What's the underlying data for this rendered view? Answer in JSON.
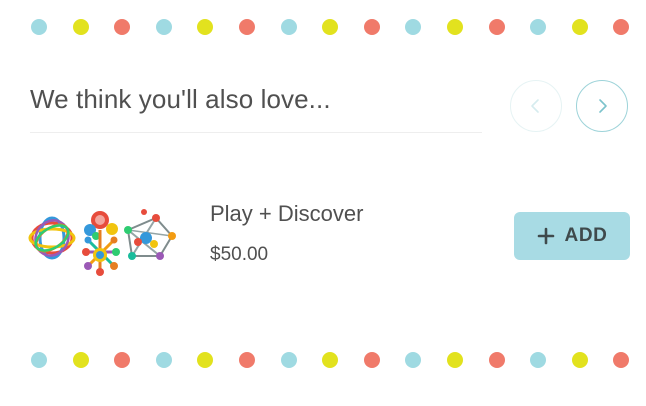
{
  "section": {
    "title": "We think you'll also love..."
  },
  "navigation": {
    "prev_icon": "chevron-left-icon",
    "next_icon": "chevron-right-icon"
  },
  "product": {
    "name": "Play + Discover",
    "price": "$50.00",
    "add_label": "ADD",
    "add_icon": "plus-icon"
  },
  "colors": {
    "accent": "#a8dbe4",
    "dot_blue": "#9fdae2",
    "dot_yellow": "#e2e21e",
    "dot_red": "#f07a6a",
    "text": "#505050"
  }
}
